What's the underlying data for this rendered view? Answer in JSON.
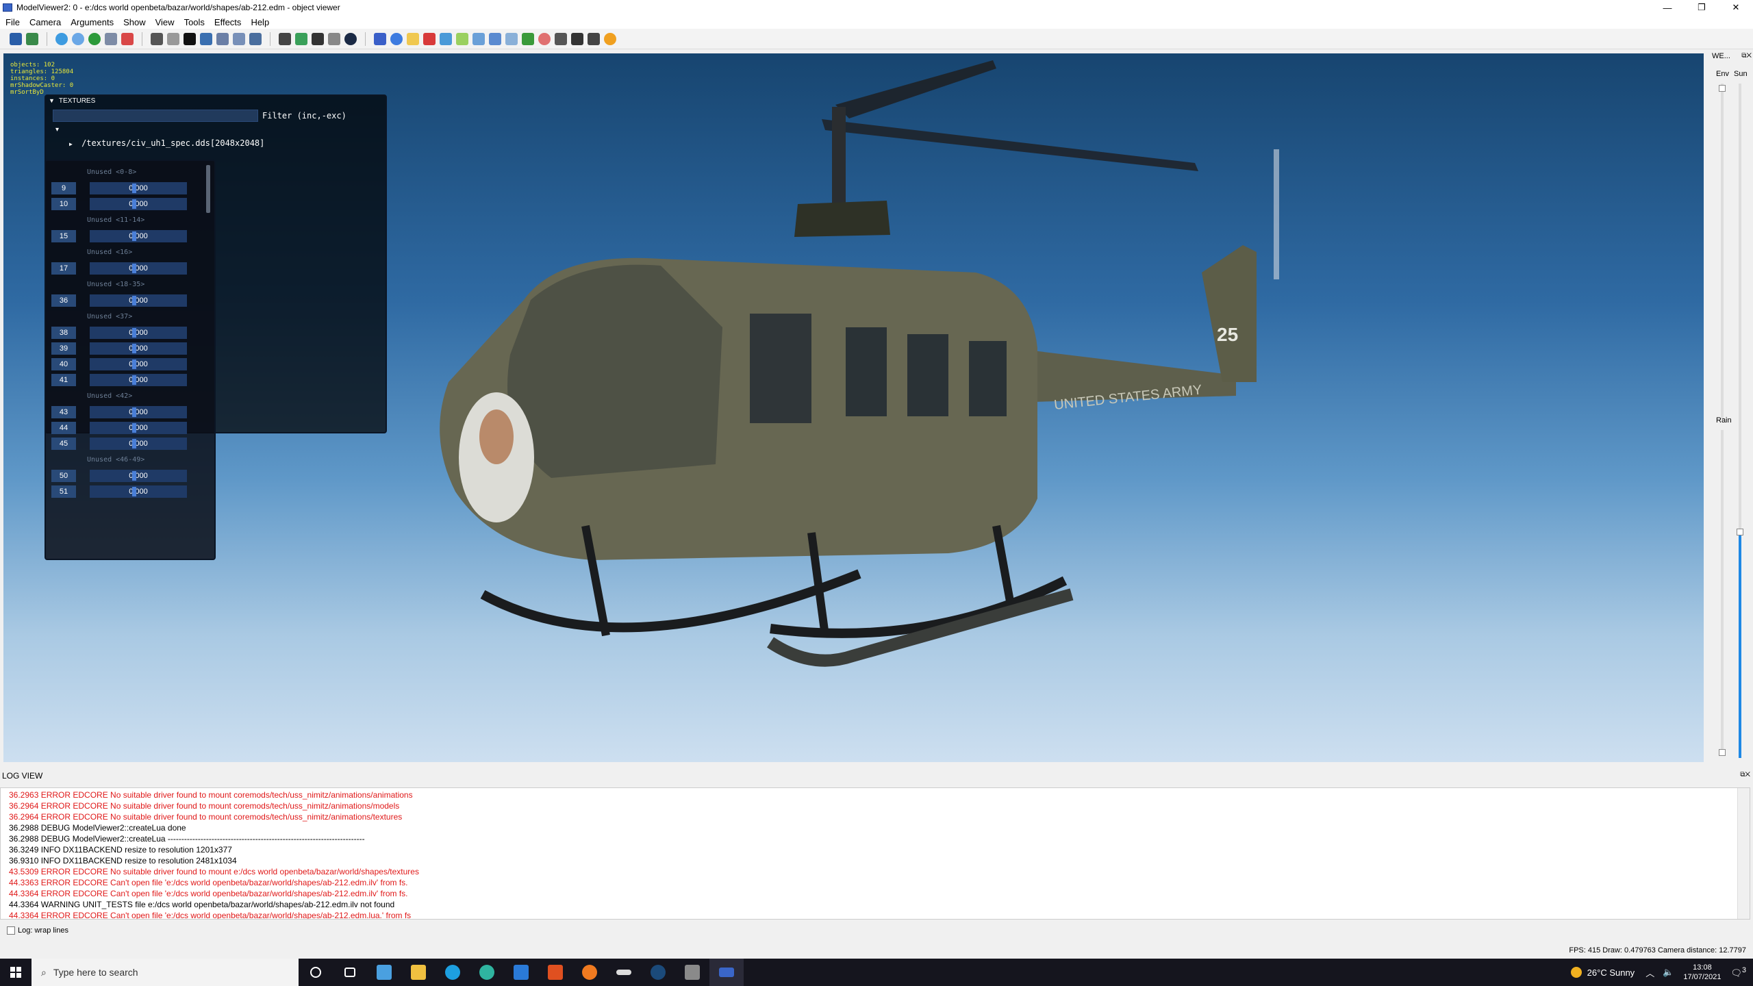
{
  "window": {
    "title": "ModelViewer2: 0 - e:/dcs world openbeta/bazar/world/shapes/ab-212.edm - object viewer",
    "min": "—",
    "max": "❐",
    "close": "✕"
  },
  "menu": [
    "File",
    "Camera",
    "Arguments",
    "Show",
    "View",
    "Tools",
    "Effects",
    "Help"
  ],
  "stats": {
    "objects": "objects: 102",
    "triangles": "triangles: 125804",
    "instances": "instances: 0",
    "shadow": "mrShadowCaster: 0",
    "sort": "mrSortByD"
  },
  "textures_panel": {
    "header": "TEXTURES",
    "filter_label": "Filter (inc,-exc)",
    "file": "/textures/civ_uh1_spec.dds[2048x2048]"
  },
  "arguments": [
    {
      "type": "unused",
      "label": "Unused <0-8>"
    },
    {
      "type": "arg",
      "num": "9",
      "value": "0.000"
    },
    {
      "type": "arg",
      "num": "10",
      "value": "0.000"
    },
    {
      "type": "unused",
      "label": "Unused <11-14>"
    },
    {
      "type": "arg",
      "num": "15",
      "value": "0.000"
    },
    {
      "type": "unused",
      "label": "Unused <16>"
    },
    {
      "type": "arg",
      "num": "17",
      "value": "0.000"
    },
    {
      "type": "unused",
      "label": "Unused <18-35>"
    },
    {
      "type": "arg",
      "num": "36",
      "value": "0.000"
    },
    {
      "type": "unused",
      "label": "Unused <37>"
    },
    {
      "type": "arg",
      "num": "38",
      "value": "0.000"
    },
    {
      "type": "arg",
      "num": "39",
      "value": "0.000"
    },
    {
      "type": "arg",
      "num": "40",
      "value": "0.000"
    },
    {
      "type": "arg",
      "num": "41",
      "value": "0.000"
    },
    {
      "type": "unused",
      "label": "Unused <42>"
    },
    {
      "type": "arg",
      "num": "43",
      "value": "0.000"
    },
    {
      "type": "arg",
      "num": "44",
      "value": "0.000"
    },
    {
      "type": "arg",
      "num": "45",
      "value": "0.000"
    },
    {
      "type": "unused",
      "label": "Unused <46-49>"
    },
    {
      "type": "arg",
      "num": "50",
      "value": "0.000"
    },
    {
      "type": "arg",
      "num": "51",
      "value": "0.000"
    }
  ],
  "weather_panel": {
    "title": "WE...",
    "env": "Env",
    "sun": "Sun",
    "rain": "Rain"
  },
  "helicopter": {
    "fuselage_text": "UNITED STATES ARMY",
    "tail_number": "25"
  },
  "log": {
    "title": "LOG VIEW",
    "lines": [
      {
        "level": "err",
        "text": "36.2963 ERROR EDCORE No suitable driver found to mount coremods/tech/uss_nimitz/animations/animations"
      },
      {
        "level": "err",
        "text": "36.2964 ERROR EDCORE No suitable driver found to mount coremods/tech/uss_nimitz/animations/models"
      },
      {
        "level": "err",
        "text": "36.2964 ERROR EDCORE No suitable driver found to mount coremods/tech/uss_nimitz/animations/textures"
      },
      {
        "level": "dbg",
        "text": "36.2988 DEBUG ModelViewer2::createLua done"
      },
      {
        "level": "dbg",
        "text": "36.2988 DEBUG ModelViewer2::createLua ------------------------------------------------------------------------"
      },
      {
        "level": "dbg",
        "text": "36.3249 INFO DX11BACKEND resize to resolution 1201x377"
      },
      {
        "level": "dbg",
        "text": "36.9310 INFO DX11BACKEND resize to resolution 2481x1034"
      },
      {
        "level": "err",
        "text": "43.5309 ERROR EDCORE No suitable driver found to mount e:/dcs world openbeta/bazar/world/shapes/textures"
      },
      {
        "level": "err",
        "text": "44.3363 ERROR EDCORE Can't open file 'e:/dcs world openbeta/bazar/world/shapes/ab-212.edm.ilv' from fs."
      },
      {
        "level": "err",
        "text": "44.3364 ERROR EDCORE Can't open file 'e:/dcs world openbeta/bazar/world/shapes/ab-212.edm.ilv' from fs."
      },
      {
        "level": "dbg",
        "text": "44.3364 WARNING UNIT_TESTS file e:/dcs world openbeta/bazar/world/shapes/ab-212.edm.ilv not found"
      },
      {
        "level": "err",
        "text": "44.3364 ERROR EDCORE Can't open file 'e:/dcs world openbeta/bazar/world/shapes/ab-212.edm.lua.' from fs"
      }
    ],
    "wrap_label": "Log: wrap lines"
  },
  "status": "FPS: 415   Draw: 0.479763   Camera distance: 12.7797",
  "taskbar": {
    "search_placeholder": "Type here to search",
    "weather": "26°C  Sunny",
    "time": "13:08",
    "date": "17/07/2021",
    "notif": "3"
  },
  "colors": {
    "log_error": "#e01818",
    "accent": "#1e88e5",
    "panel_bg": "#0a0e18"
  }
}
